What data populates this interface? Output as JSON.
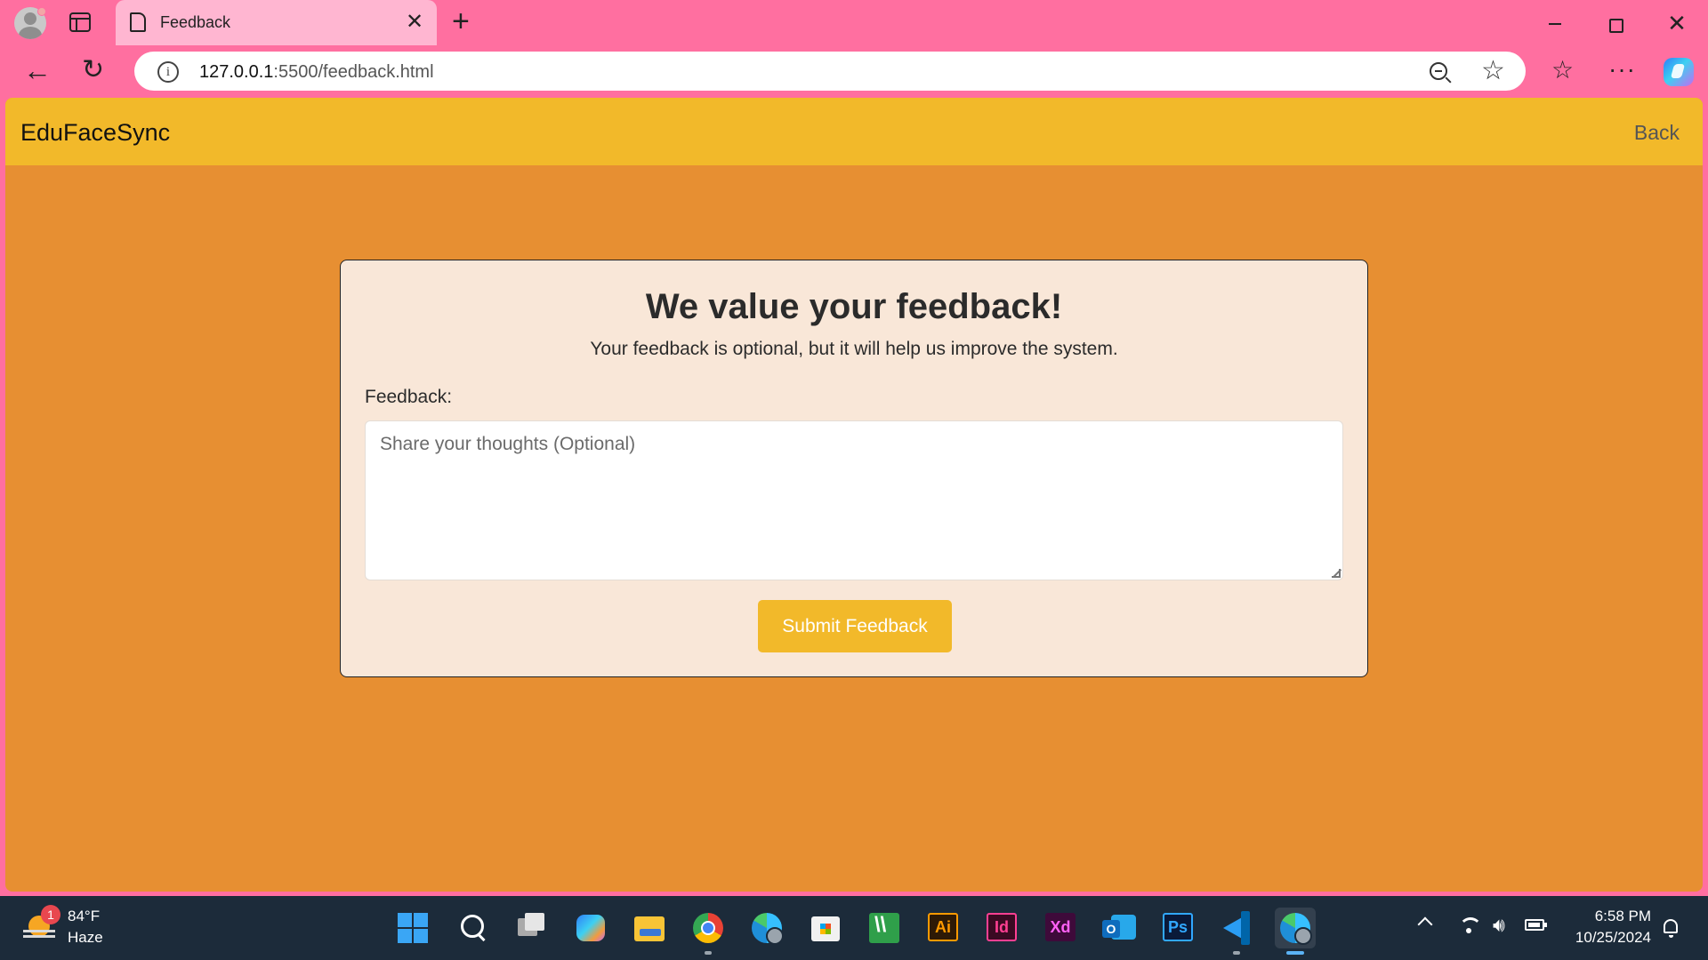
{
  "browser": {
    "tab_title": "Feedback",
    "url_host": "127.0.0.1",
    "url_path": ":5500/feedback.html"
  },
  "site": {
    "brand": "EduFaceSync",
    "back_label": "Back"
  },
  "feedback_card": {
    "title": "We value your feedback!",
    "subtitle": "Your feedback is optional, but it will help us improve the system.",
    "label": "Feedback:",
    "placeholder": "Share your thoughts (Optional)",
    "value": "",
    "submit_label": "Submit Feedback"
  },
  "colors": {
    "page_background": "#e78f32",
    "navbar": "#f2b92a",
    "card_background": "#f9e7d8",
    "submit_button": "#f2b92a",
    "browser_chrome": "#ff6fa0"
  },
  "taskbar": {
    "weather": {
      "temperature": "84°F",
      "condition": "Haze",
      "badge": "1"
    },
    "apps": [
      "start",
      "search",
      "task-view",
      "copilot",
      "file-explorer",
      "chrome",
      "edge-profile",
      "microsoft-store",
      "sketch-app",
      "illustrator",
      "indesign",
      "xd",
      "outlook",
      "photoshop",
      "vscode",
      "edge"
    ],
    "adobe_labels": {
      "illustrator": "Ai",
      "indesign": "Id",
      "xd": "Xd",
      "photoshop": "Ps"
    },
    "clock": {
      "time": "6:58 PM",
      "date": "10/25/2024"
    }
  }
}
